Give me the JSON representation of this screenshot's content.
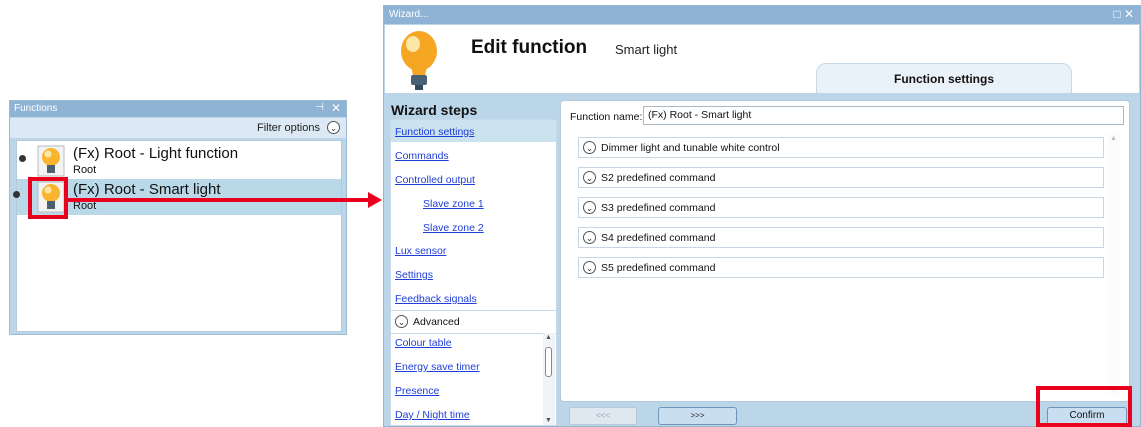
{
  "functions_panel": {
    "title": "Functions",
    "pin_glyph": "⊣",
    "close_glyph": "✕",
    "filter_label": "Filter options",
    "items": [
      {
        "name": "(Fx) Root - Light function",
        "parent": "Root"
      },
      {
        "name": "(Fx) Root - Smart light",
        "parent": "Root"
      }
    ]
  },
  "wizard": {
    "title": "Wizard...",
    "window_buttons": "□ ✕",
    "header_title": "Edit function",
    "header_subtitle": "Smart light",
    "tab_label": "Function settings",
    "steps_title": "Wizard steps",
    "steps": [
      "Function settings",
      "Commands",
      "Controlled output",
      "Slave zone 1",
      "Slave zone 2",
      "Lux sensor",
      "Settings",
      "Feedback signals"
    ],
    "advanced_label": "Advanced",
    "advanced_steps": [
      "Colour table",
      "Energy save timer",
      "Presence",
      "Day / Night time"
    ],
    "function_name_label": "Function name:",
    "function_name_value": "(Fx) Root - Smart light",
    "sections": [
      "Dimmer light and tunable white control",
      "S2 predefined command",
      "S3 predefined command",
      "S4 predefined command",
      "S5 predefined command"
    ],
    "prev_label": "<<<",
    "next_label": ">>>",
    "confirm_label": "Confirm"
  },
  "colors": {
    "accent_red": "#e8001c",
    "panel_blue": "#bcd6e9",
    "link_blue": "#1f3ed8"
  }
}
